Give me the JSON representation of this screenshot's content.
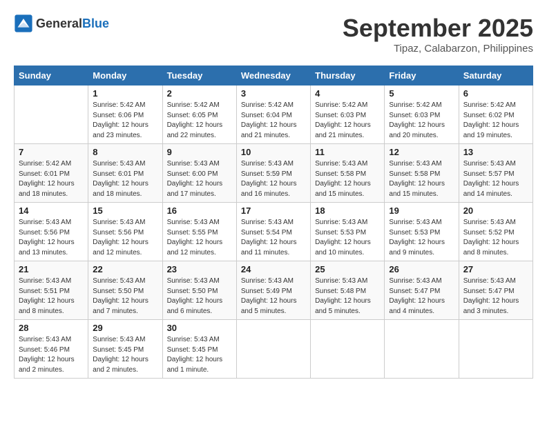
{
  "header": {
    "logo_general": "General",
    "logo_blue": "Blue",
    "month": "September 2025",
    "location": "Tipaz, Calabarzon, Philippines"
  },
  "weekdays": [
    "Sunday",
    "Monday",
    "Tuesday",
    "Wednesday",
    "Thursday",
    "Friday",
    "Saturday"
  ],
  "weeks": [
    [
      {
        "day": "",
        "info": ""
      },
      {
        "day": "1",
        "info": "Sunrise: 5:42 AM\nSunset: 6:06 PM\nDaylight: 12 hours\nand 23 minutes."
      },
      {
        "day": "2",
        "info": "Sunrise: 5:42 AM\nSunset: 6:05 PM\nDaylight: 12 hours\nand 22 minutes."
      },
      {
        "day": "3",
        "info": "Sunrise: 5:42 AM\nSunset: 6:04 PM\nDaylight: 12 hours\nand 21 minutes."
      },
      {
        "day": "4",
        "info": "Sunrise: 5:42 AM\nSunset: 6:03 PM\nDaylight: 12 hours\nand 21 minutes."
      },
      {
        "day": "5",
        "info": "Sunrise: 5:42 AM\nSunset: 6:03 PM\nDaylight: 12 hours\nand 20 minutes."
      },
      {
        "day": "6",
        "info": "Sunrise: 5:42 AM\nSunset: 6:02 PM\nDaylight: 12 hours\nand 19 minutes."
      }
    ],
    [
      {
        "day": "7",
        "info": "Sunrise: 5:42 AM\nSunset: 6:01 PM\nDaylight: 12 hours\nand 18 minutes."
      },
      {
        "day": "8",
        "info": "Sunrise: 5:43 AM\nSunset: 6:01 PM\nDaylight: 12 hours\nand 18 minutes."
      },
      {
        "day": "9",
        "info": "Sunrise: 5:43 AM\nSunset: 6:00 PM\nDaylight: 12 hours\nand 17 minutes."
      },
      {
        "day": "10",
        "info": "Sunrise: 5:43 AM\nSunset: 5:59 PM\nDaylight: 12 hours\nand 16 minutes."
      },
      {
        "day": "11",
        "info": "Sunrise: 5:43 AM\nSunset: 5:58 PM\nDaylight: 12 hours\nand 15 minutes."
      },
      {
        "day": "12",
        "info": "Sunrise: 5:43 AM\nSunset: 5:58 PM\nDaylight: 12 hours\nand 15 minutes."
      },
      {
        "day": "13",
        "info": "Sunrise: 5:43 AM\nSunset: 5:57 PM\nDaylight: 12 hours\nand 14 minutes."
      }
    ],
    [
      {
        "day": "14",
        "info": "Sunrise: 5:43 AM\nSunset: 5:56 PM\nDaylight: 12 hours\nand 13 minutes."
      },
      {
        "day": "15",
        "info": "Sunrise: 5:43 AM\nSunset: 5:56 PM\nDaylight: 12 hours\nand 12 minutes."
      },
      {
        "day": "16",
        "info": "Sunrise: 5:43 AM\nSunset: 5:55 PM\nDaylight: 12 hours\nand 12 minutes."
      },
      {
        "day": "17",
        "info": "Sunrise: 5:43 AM\nSunset: 5:54 PM\nDaylight: 12 hours\nand 11 minutes."
      },
      {
        "day": "18",
        "info": "Sunrise: 5:43 AM\nSunset: 5:53 PM\nDaylight: 12 hours\nand 10 minutes."
      },
      {
        "day": "19",
        "info": "Sunrise: 5:43 AM\nSunset: 5:53 PM\nDaylight: 12 hours\nand 9 minutes."
      },
      {
        "day": "20",
        "info": "Sunrise: 5:43 AM\nSunset: 5:52 PM\nDaylight: 12 hours\nand 8 minutes."
      }
    ],
    [
      {
        "day": "21",
        "info": "Sunrise: 5:43 AM\nSunset: 5:51 PM\nDaylight: 12 hours\nand 8 minutes."
      },
      {
        "day": "22",
        "info": "Sunrise: 5:43 AM\nSunset: 5:50 PM\nDaylight: 12 hours\nand 7 minutes."
      },
      {
        "day": "23",
        "info": "Sunrise: 5:43 AM\nSunset: 5:50 PM\nDaylight: 12 hours\nand 6 minutes."
      },
      {
        "day": "24",
        "info": "Sunrise: 5:43 AM\nSunset: 5:49 PM\nDaylight: 12 hours\nand 5 minutes."
      },
      {
        "day": "25",
        "info": "Sunrise: 5:43 AM\nSunset: 5:48 PM\nDaylight: 12 hours\nand 5 minutes."
      },
      {
        "day": "26",
        "info": "Sunrise: 5:43 AM\nSunset: 5:47 PM\nDaylight: 12 hours\nand 4 minutes."
      },
      {
        "day": "27",
        "info": "Sunrise: 5:43 AM\nSunset: 5:47 PM\nDaylight: 12 hours\nand 3 minutes."
      }
    ],
    [
      {
        "day": "28",
        "info": "Sunrise: 5:43 AM\nSunset: 5:46 PM\nDaylight: 12 hours\nand 2 minutes."
      },
      {
        "day": "29",
        "info": "Sunrise: 5:43 AM\nSunset: 5:45 PM\nDaylight: 12 hours\nand 2 minutes."
      },
      {
        "day": "30",
        "info": "Sunrise: 5:43 AM\nSunset: 5:45 PM\nDaylight: 12 hours\nand 1 minute."
      },
      {
        "day": "",
        "info": ""
      },
      {
        "day": "",
        "info": ""
      },
      {
        "day": "",
        "info": ""
      },
      {
        "day": "",
        "info": ""
      }
    ]
  ]
}
